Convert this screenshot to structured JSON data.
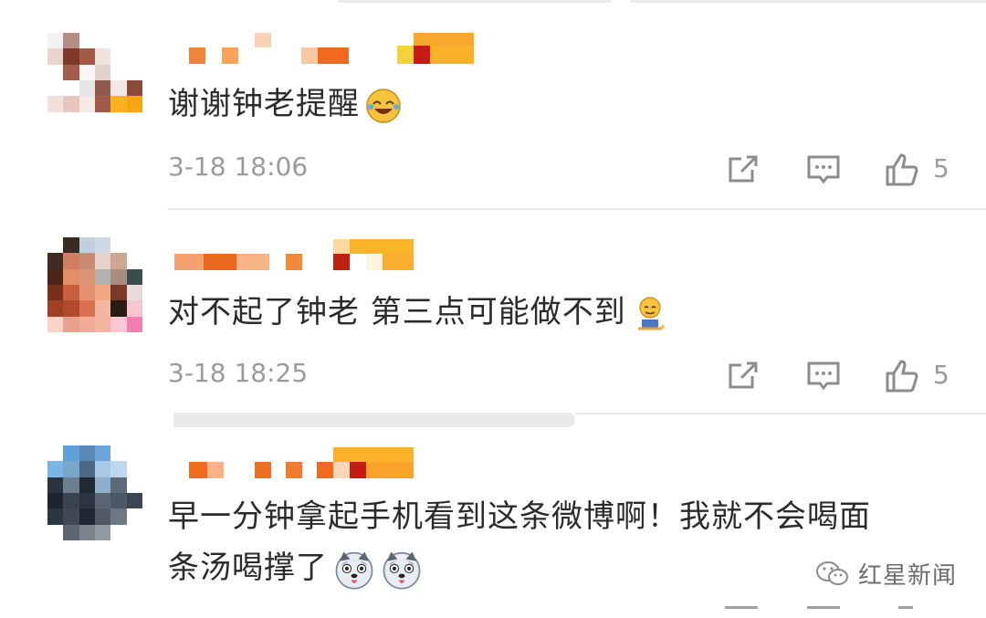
{
  "comments": [
    {
      "text": "谢谢钟老提醒",
      "emoji": "laughing-crying-emoji",
      "time": "3-18 18:06",
      "likes": "5"
    },
    {
      "text": "对不起了钟老 第三点可能做不到",
      "emoji": "sweating-kneeling-emoji",
      "time": "3-18 18:25",
      "likes": "5"
    },
    {
      "text_line1": "早一分钟拿起手机看到这条微博啊！我就不会喝面",
      "text_line2": "条汤喝撑了",
      "emoji": "husky-dog-emoji"
    }
  ],
  "watermark": {
    "label": "红星新闻",
    "icon": "wechat-icon"
  },
  "colors": {
    "text": "#2b2b2b",
    "meta": "#9b9b9b",
    "divider": "#ededed",
    "name_blur": "#f08a3a"
  }
}
